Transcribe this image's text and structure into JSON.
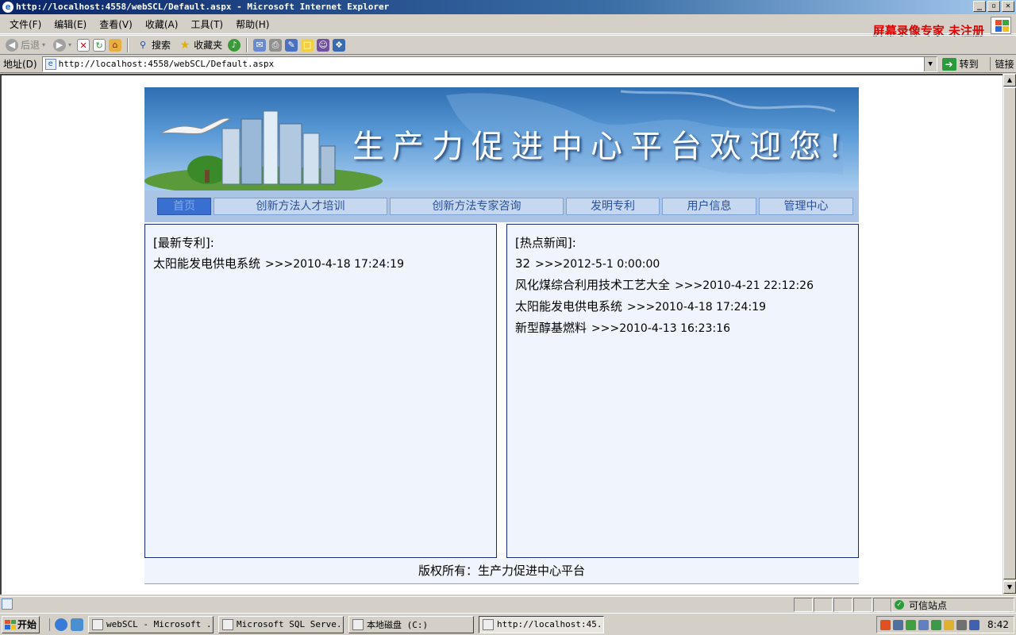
{
  "window": {
    "title": "http://localhost:4558/webSCL/Default.aspx - Microsoft Internet Explorer",
    "buttons": [
      "_",
      "▫",
      "✕"
    ]
  },
  "menubar": {
    "items": [
      "文件(F)",
      "编辑(E)",
      "查看(V)",
      "收藏(A)",
      "工具(T)",
      "帮助(H)"
    ],
    "watermark": "屏幕录像专家 未注册"
  },
  "toolbar": {
    "back": "后退",
    "search": "搜索",
    "favorites": "收藏夹"
  },
  "address": {
    "label": "地址(D)",
    "url": "http://localhost:4558/webSCL/Default.aspx",
    "go": "转到",
    "links": "链接"
  },
  "site": {
    "banner_title": "生产力促进中心平台欢迎您!",
    "nav": [
      {
        "label": "首页",
        "active": true
      },
      {
        "label": "创新方法人才培训"
      },
      {
        "label": "创新方法专家咨询"
      },
      {
        "label": "发明专利"
      },
      {
        "label": "用户信息"
      },
      {
        "label": "管理中心"
      }
    ],
    "left_panel": {
      "heading": "[最新专利]:",
      "rows": [
        {
          "title": "太阳能发电供电系统",
          "time": ">>>2010-4-18 17:24:19"
        }
      ]
    },
    "right_panel": {
      "heading": "[热点新闻]:",
      "rows": [
        {
          "title": "32",
          "time": ">>>2012-5-1 0:00:00"
        },
        {
          "title": "风化煤综合利用技术工艺大全",
          "time": ">>>2010-4-21 22:12:26"
        },
        {
          "title": "太阳能发电供电系统",
          "time": ">>>2010-4-18 17:24:19"
        },
        {
          "title": "新型醇基燃料",
          "time": ">>>2010-4-13 16:23:16"
        }
      ]
    },
    "footer": "版权所有：生产力促进中心平台"
  },
  "statusbar": {
    "zone": "可信站点"
  },
  "taskbar": {
    "start": "开始",
    "tasks": [
      {
        "label": "webSCL - Microsoft ...",
        "active": false
      },
      {
        "label": "Microsoft SQL Serve...",
        "active": false
      },
      {
        "label": "本地磁盘 (C:)",
        "active": false
      },
      {
        "label": "http://localhost:45...",
        "active": true
      }
    ],
    "clock": "8:42"
  },
  "colors": {
    "banner_blue": "#2f6fb3",
    "nav_bg": "#a9c4e4",
    "nav_active": "#3a6fd2",
    "panel_bg": "#f0f4fc",
    "panel_border": "#1a2a7a",
    "watermark_red": "#e00000"
  }
}
